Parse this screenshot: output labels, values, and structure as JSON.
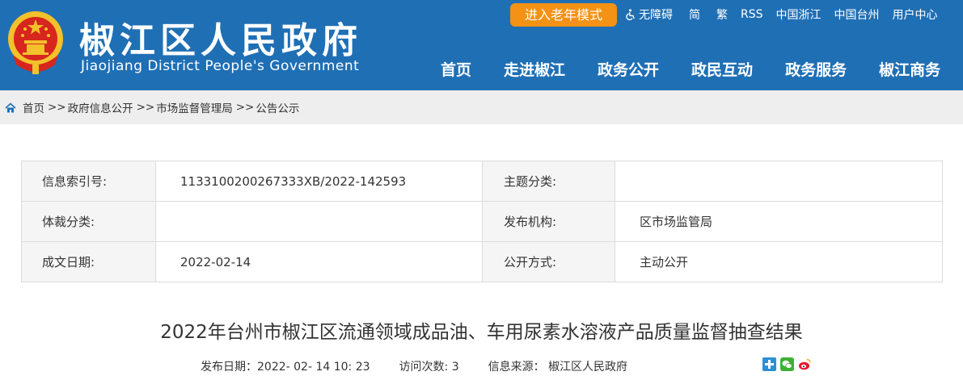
{
  "header": {
    "title": "椒江区人民政府",
    "subtitle": "Jiaojiang District People's Government",
    "elder_mode": "进入老年模式",
    "toplinks": {
      "accessibility": "无障碍",
      "simplified": "简",
      "traditional": "繁",
      "rss": "RSS",
      "zhejiang": "中国浙江",
      "taizhou": "中国台州",
      "user_center": "用户中心"
    },
    "nav": [
      "首页",
      "走进椒江",
      "政务公开",
      "政民互动",
      "政务服务",
      "椒江商务"
    ]
  },
  "breadcrumb": {
    "items": [
      "首页",
      "政府信息公开",
      "市场监督管理局",
      "公告公示"
    ],
    "separator": ">>"
  },
  "info": {
    "index_label": "信息索引号:",
    "index_value": "1133100200267333XB/2022-142593",
    "topic_label": "主题分类:",
    "topic_value": "",
    "genre_label": "体裁分类:",
    "genre_value": "",
    "publisher_label": "发布机构:",
    "publisher_value": "区市场监管局",
    "date_label": "成文日期:",
    "date_value": "2022-02-14",
    "open_label": "公开方式:",
    "open_value": "主动公开"
  },
  "article": {
    "title": "2022年台州市椒江区流通领域成品油、车用尿素水溶液产品质量监督抽查结果",
    "publish_label": "发布日期：",
    "publish_value": "2022- 02- 14 10: 23",
    "visits_label": "访问次数:",
    "visits_value": "3",
    "source_label": "信息来源：",
    "source_value": "椒江区人民政府"
  },
  "colors": {
    "header_blue": "#1f6fb5",
    "elder_orange": "#f39214",
    "crumb_bg": "#eeeeee",
    "label_bg": "#f5f5f5"
  }
}
